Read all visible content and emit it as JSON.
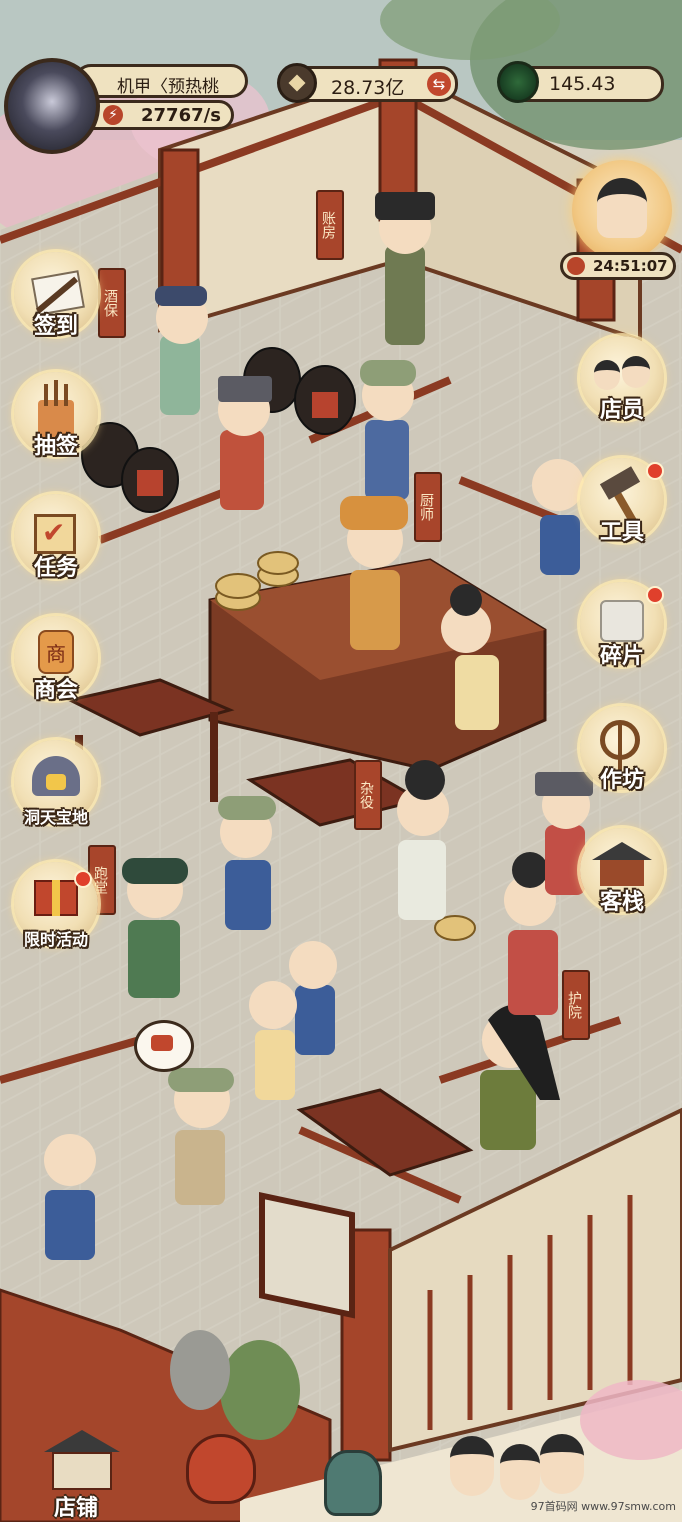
{
  "player": {
    "name": "机甲〈预热桃",
    "income_rate": "27767/s"
  },
  "currency": {
    "coins": "28.73亿",
    "jade": "145.43"
  },
  "event_timer": "24:51:07",
  "side_left": [
    {
      "label": "签到",
      "icon": "brush-scroll-icon"
    },
    {
      "label": "抽签",
      "icon": "fortune-sticks-icon"
    },
    {
      "label": "任务",
      "icon": "task-book-icon"
    },
    {
      "label": "商会",
      "icon": "merchant-lantern-icon",
      "badge": "商"
    },
    {
      "label": "洞天宝地",
      "icon": "treasure-cave-icon"
    },
    {
      "label": "限时活动",
      "icon": "gift-box-icon"
    }
  ],
  "side_right": [
    {
      "label": "店员",
      "icon": "staff-icon"
    },
    {
      "label": "工具",
      "icon": "hammer-icon"
    },
    {
      "label": "碎片",
      "icon": "puzzle-icon"
    },
    {
      "label": "作坊",
      "icon": "spinning-wheel-icon"
    },
    {
      "label": "客栈",
      "icon": "inn-icon"
    }
  ],
  "room_signs": [
    "账房",
    "酒保",
    "厨师",
    "杂役",
    "跑堂",
    "护院"
  ],
  "bottom_nav": [
    {
      "label": "店铺",
      "icon": "shop-building-icon"
    }
  ],
  "watermark": "97首码网 www.97smw.com",
  "colors": {
    "floor": "#cfcabb",
    "wood": "#8b3a22",
    "pill_bg": "#efe2c0",
    "accent_red": "#a8452b"
  }
}
